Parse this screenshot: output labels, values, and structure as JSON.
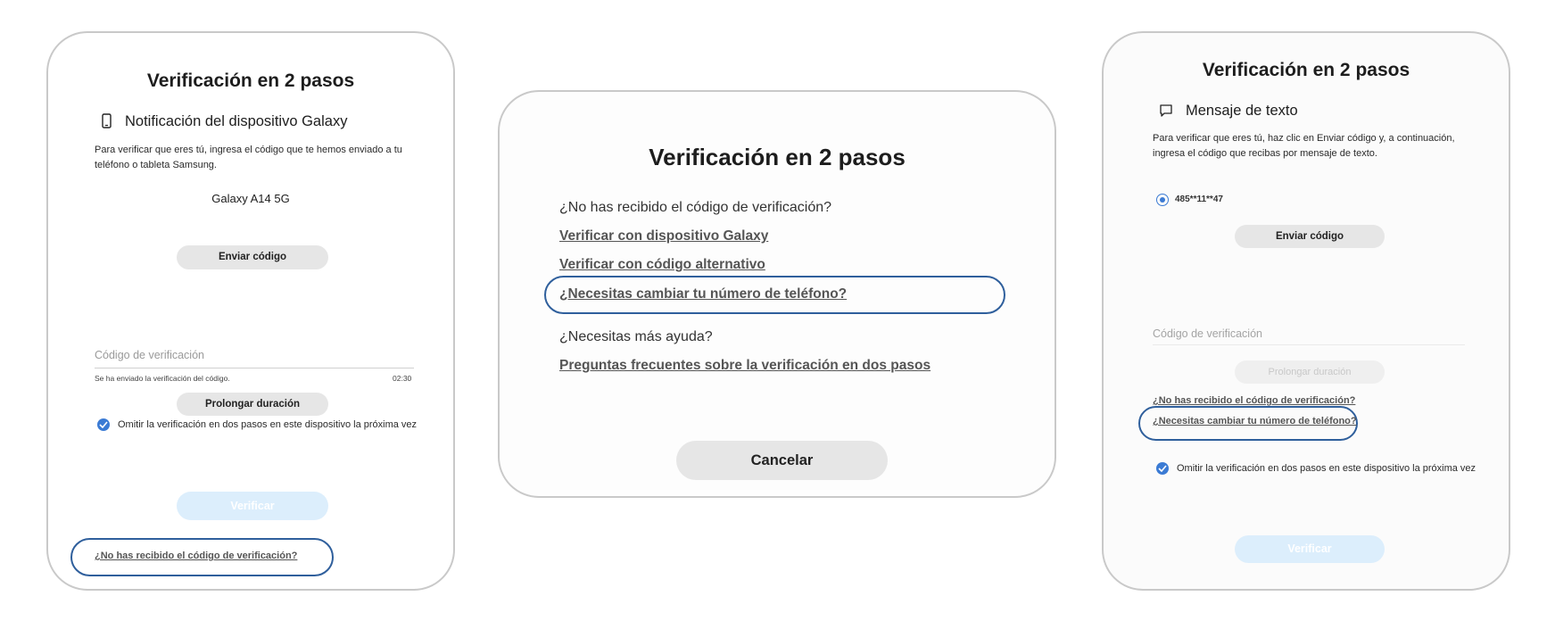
{
  "panel_left": {
    "title": "Verificación en 2 pasos",
    "method_icon": "phone-icon",
    "method_label": "Notificación del dispositivo Galaxy",
    "description": "Para verificar que eres tú, ingresa el código que te hemos enviado a tu teléfono o tableta Samsung.",
    "device_name": "Galaxy A14 5G",
    "send_code_button": "Enviar código",
    "code_placeholder": "Código de verificación",
    "sent_note": "Se ha enviado la verificación del código.",
    "timer": "02:30",
    "extend_button": "Prolongar duración",
    "skip_checkbox_label": "Omitir la verificación en dos pasos en este dispositivo la próxima vez",
    "skip_checked": true,
    "verify_button": "Verificar",
    "not_received_link": "¿No has recibido el código de verificación?"
  },
  "panel_middle": {
    "title": "Verificación en 2 pasos",
    "question": "¿No has recibido el código de verificación?",
    "link_galaxy": "Verificar con dispositivo Galaxy",
    "link_alt_code": "Verificar con código alternativo",
    "link_change_phone": "¿Necesitas cambiar tu número de teléfono?",
    "help_question": "¿Necesitas más ayuda?",
    "link_faq": "Preguntas frecuentes sobre la verificación en dos pasos",
    "cancel_button": "Cancelar"
  },
  "panel_right": {
    "title": "Verificación en 2 pasos",
    "method_icon": "message-icon",
    "method_label": "Mensaje de texto",
    "description": "Para verificar que eres tú, haz clic en Enviar código y, a continuación, ingresa el código que recibas por mensaje de texto.",
    "phone_number": "485**11**47",
    "send_code_button": "Enviar código",
    "code_placeholder": "Código de verificación",
    "extend_button": "Prolongar duración",
    "not_received_link": "¿No has recibido el código de verificación?",
    "change_phone_link": "¿Necesitas cambiar tu número de teléfono?",
    "skip_checkbox_label": "Omitir la verificación en dos pasos en este dispositivo la próxima vez",
    "skip_checked": true,
    "verify_button": "Verificar"
  },
  "colors": {
    "highlight": "#2f5f9c",
    "accent": "#3b7bd4",
    "disabled_button": "#dceefc",
    "panel_border": "#c9c9c9"
  }
}
